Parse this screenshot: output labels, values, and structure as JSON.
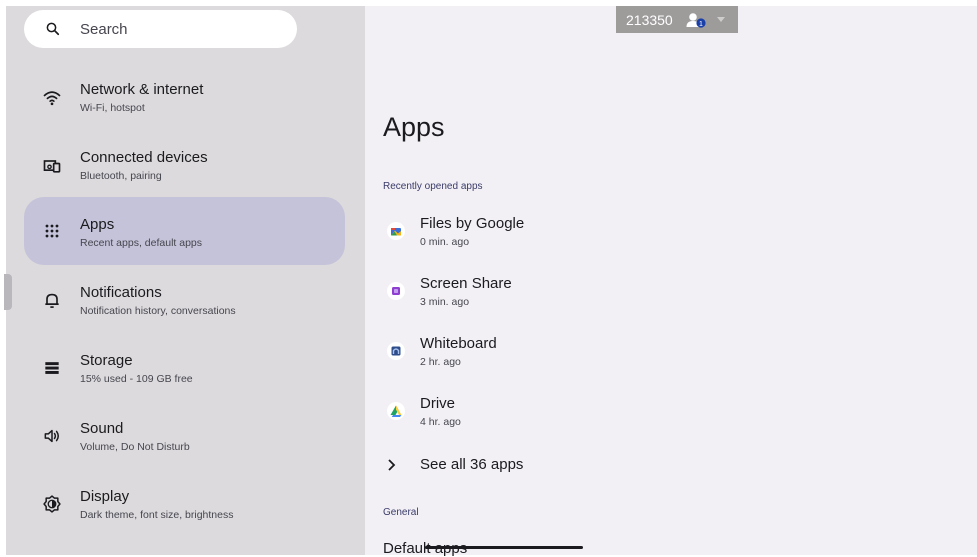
{
  "search": {
    "placeholder": "Search",
    "icon": "search-icon"
  },
  "sidebar": {
    "items": [
      {
        "title": "Network & internet",
        "subtitle": "Wi-Fi, hotspot",
        "icon": "wifi-icon"
      },
      {
        "title": "Connected devices",
        "subtitle": "Bluetooth, pairing",
        "icon": "connected-devices-icon"
      },
      {
        "title": "Apps",
        "subtitle": "Recent apps, default apps",
        "icon": "apps-grid-icon",
        "selected": true
      },
      {
        "title": "Notifications",
        "subtitle": "Notification history, conversations",
        "icon": "bell-icon"
      },
      {
        "title": "Storage",
        "subtitle": "15% used - 109 GB free",
        "icon": "storage-icon"
      },
      {
        "title": "Sound",
        "subtitle": "Volume, Do Not Disturb",
        "icon": "speaker-icon"
      },
      {
        "title": "Display",
        "subtitle": "Dark theme, font size, brightness",
        "icon": "brightness-icon"
      }
    ]
  },
  "badge": {
    "text": "213350",
    "icon": "user-badge-icon",
    "count": "1"
  },
  "main": {
    "title": "Apps",
    "recent_header": "Recently opened apps",
    "apps": [
      {
        "name": "Files by Google",
        "time": "0 min. ago",
        "icon": "files-by-google-icon"
      },
      {
        "name": "Screen Share",
        "time": "3 min. ago",
        "icon": "screen-share-icon"
      },
      {
        "name": "Whiteboard",
        "time": "2 hr. ago",
        "icon": "whiteboard-icon"
      },
      {
        "name": "Drive",
        "time": "4 hr. ago",
        "icon": "drive-icon"
      }
    ],
    "see_all": "See all 36 apps",
    "general_header": "General",
    "default_apps": "Default apps"
  },
  "colors": {
    "sidebar_bg": "#dcdadc",
    "main_bg": "#f2f0f4",
    "selected_bg": "#c4c3d9",
    "section_header": "#3a3b6a"
  }
}
